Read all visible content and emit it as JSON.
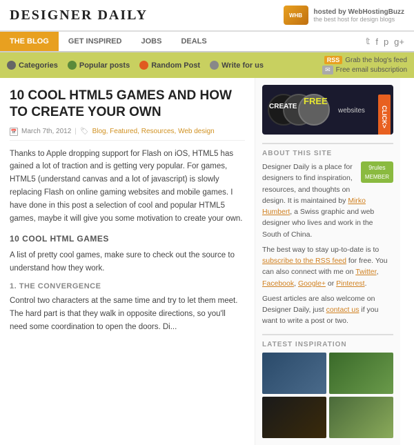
{
  "site": {
    "title": "DESIGNER DAILY",
    "hosted_label": "hosted by WebHostingBuzz",
    "hosted_sub": "the best host for design blogs"
  },
  "nav": {
    "items": [
      {
        "label": "THE BLOG",
        "active": true
      },
      {
        "label": "GET INSPIRED",
        "active": false
      },
      {
        "label": "JOBS",
        "active": false
      },
      {
        "label": "DEALS",
        "active": false
      }
    ],
    "social": [
      "f",
      "t",
      "p",
      "g+"
    ]
  },
  "subnav": {
    "items": [
      {
        "label": "Categories",
        "icon": "cat"
      },
      {
        "label": "Popular posts",
        "icon": "pop"
      },
      {
        "label": "Random Post",
        "icon": "rand"
      },
      {
        "label": "Write for us",
        "icon": "write"
      }
    ],
    "rss_label": "Grab the blog's feed",
    "email_label": "Free email subscription"
  },
  "article": {
    "title": "10 COOL HTML5 GAMES AND HOW TO CREATE YOUR OWN",
    "date": "March 7th, 2012",
    "tags": "Blog, Featured, Resources, Web design",
    "body1": "Thanks to Apple dropping support for Flash on iOS, HTML5 has gained a lot of traction and is getting very popular. For games, HTML5 (understand canvas and a lot of javascript) is slowly replacing Flash on online gaming websites and mobile games. I have done in this post a selection of cool and popular HTML5 games, maybe it will give you some motivation to create your own.",
    "section1": "10 COOL HTML GAMES",
    "body2": "A list of pretty cool games, make sure to check out the source to understand how they work.",
    "sub1": "1. THE CONVERGENCE",
    "body3": "Control two characters at the same time and try to let them meet. The hard part is that they walk in opposite directions, so you'll need some coordination to open the doors. Di..."
  },
  "sidebar": {
    "about_heading": "ABOUT THIS SITE",
    "about_text1": "Designer Daily is a place for designers to find inspiration, resources, and thoughts on design. It is maintained by ",
    "about_link1": "Mirko Humbert",
    "about_text2": ", a Swiss graphic and web designer who lives and work in the South of China.",
    "about_text3": "The best way to stay up-to-date is to ",
    "about_link2": "subscribe to the RSS feed",
    "about_text4": " for free. You can also connect with me on ",
    "about_link3": "Twitter",
    "about_text5": ", ",
    "about_link4": "Facebook",
    "about_text6": ", ",
    "about_link5": "Google+",
    "about_text7": " or ",
    "about_link6": "Pinterest",
    "about_text8": ".",
    "about_text9": "Guest articles are also welcome on Designer Daily, just ",
    "about_link7": "contact us",
    "about_text10": " if you want to write a post or two.",
    "latest_heading": "LATEST INSPIRATION"
  }
}
